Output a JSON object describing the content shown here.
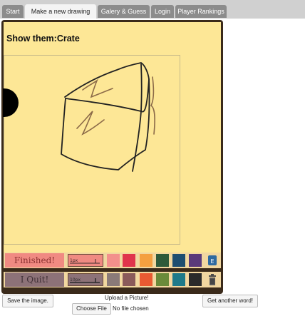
{
  "tabs": [
    {
      "label": "Start"
    },
    {
      "label": "Make a new drawing"
    },
    {
      "label": "Galery & Guess"
    },
    {
      "label": "Login"
    },
    {
      "label": "Player Rankings"
    }
  ],
  "prompt": "Show them:Crate",
  "toolbar": {
    "finished_label": "Finished!",
    "quit_label": "I Quit!",
    "pen_sizes": [
      "1px",
      "10px"
    ],
    "palette_row1": [
      "#f3908c",
      "#e0344c",
      "#f4a040",
      "#2e5a3a",
      "#1e4e70",
      "#5a3a7a"
    ],
    "palette_row2": [
      "#8a7a78",
      "#8a5a5a",
      "#e85a32",
      "#6a8a3a",
      "#1e7a8a",
      "#2a2a2a"
    ],
    "eraser_icon": "eraser-icon",
    "trash_icon": "trash-icon"
  },
  "actions": {
    "save_label": "Save the image.",
    "upload_label": "Upload a Picture!",
    "choose_file_label": "Choose File",
    "file_status": "No file chosen",
    "another_word_label": "Get another word!"
  }
}
